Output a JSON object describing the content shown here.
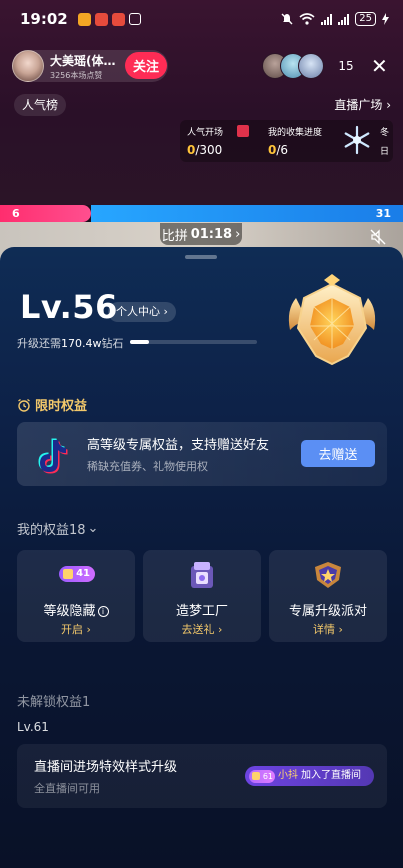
{
  "status_bar": {
    "time": "19:02",
    "battery": "25",
    "app_colors": [
      "#f3a624",
      "#e64b3c",
      "#e64b3c"
    ],
    "icons": [
      "mute-icon",
      "wifi-icon",
      "signal-icon",
      "signal-icon",
      "battery-icon",
      "charging-icon"
    ]
  },
  "live_header": {
    "host_name": "大美瑶(体…",
    "host_likes": "3256本场点赞",
    "follow_label": "关注",
    "viewer_count": "15",
    "close_symbol": "✕",
    "rank_label": "人气榜",
    "plaza_label": "直播广场"
  },
  "task_card": {
    "task1_label": "人气开场",
    "task1_current": "0",
    "task1_total": "/300",
    "task2_label": "我的收集进度",
    "task2_current": "0",
    "task2_total": "/6",
    "season_top": "冬",
    "season_bottom": "日"
  },
  "pk": {
    "left_score": "6",
    "right_score": "31",
    "timer_label": "比拼",
    "timer_value": "01:18",
    "left_share": 0.225
  },
  "level_panel": {
    "level": "Lv.56",
    "personal_center": "个人中心",
    "need_prefix": "升级还需",
    "need_amount": "170.4w",
    "need_suffix": "钻石",
    "progress": 0.15
  },
  "limited": {
    "title": "限时权益",
    "promo_title": "高等级专属权益，支持赠送好友",
    "promo_sub": "稀缺充值券、礼物使用权",
    "gift_button": "去赠送"
  },
  "benefits": {
    "title": "我的权益18",
    "items": [
      {
        "badge": "41",
        "name": "等级隐藏",
        "action": "开启"
      },
      {
        "name": "造梦工厂",
        "action": "去送礼"
      },
      {
        "name": "专属升级派对",
        "action": "详情"
      }
    ]
  },
  "locked": {
    "title": "未解锁权益1",
    "level": "Lv.61",
    "name": "直播间进场特效样式升级",
    "scope": "全直播间可用",
    "chip_badge": "61",
    "chip_user": "小抖",
    "chip_text": "加入了直播间"
  },
  "colors": {
    "follow": "#fe2c55",
    "pk_left": "#ff2d6e",
    "pk_right": "#27a6ff",
    "gold": "#f2c86b",
    "gift_button": "#5b8ff4"
  }
}
